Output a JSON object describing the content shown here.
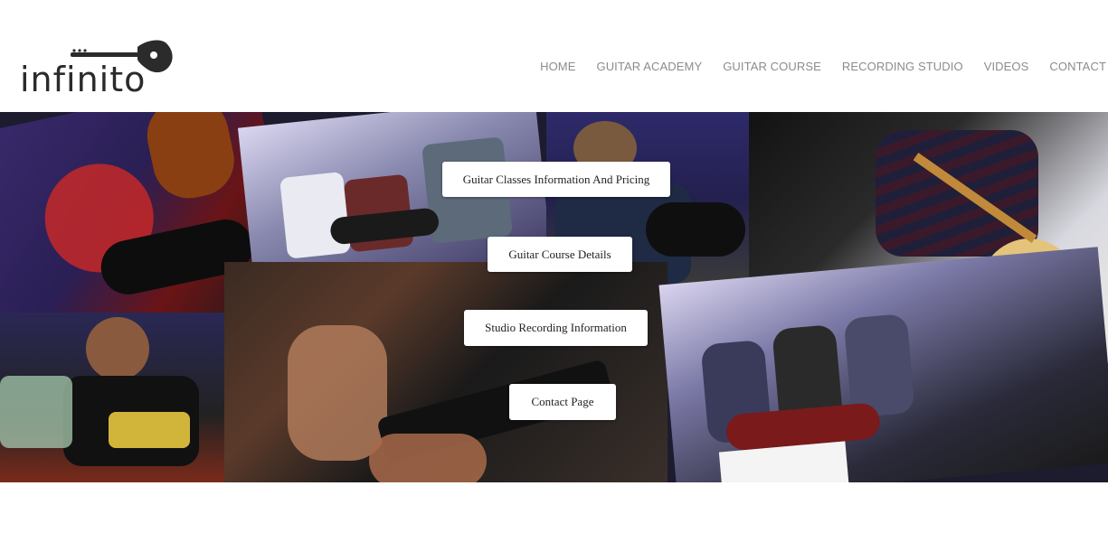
{
  "brand": {
    "logo_text": "infinito",
    "logo_color": "#2b2b2b"
  },
  "nav": {
    "items": [
      {
        "label": "HOME"
      },
      {
        "label": "GUITAR ACADEMY"
      },
      {
        "label": "GUITAR COURSE"
      },
      {
        "label": "RECORDING STUDIO"
      },
      {
        "label": "VIDEOS"
      },
      {
        "label": "CONTACT"
      }
    ],
    "color": "#8c8c8c"
  },
  "hero": {
    "buttons": [
      {
        "label": "Guitar Classes Information And Pricing"
      },
      {
        "label": "Guitar Course Details"
      },
      {
        "label": "Studio Recording Information"
      },
      {
        "label": "Contact Page"
      }
    ]
  }
}
